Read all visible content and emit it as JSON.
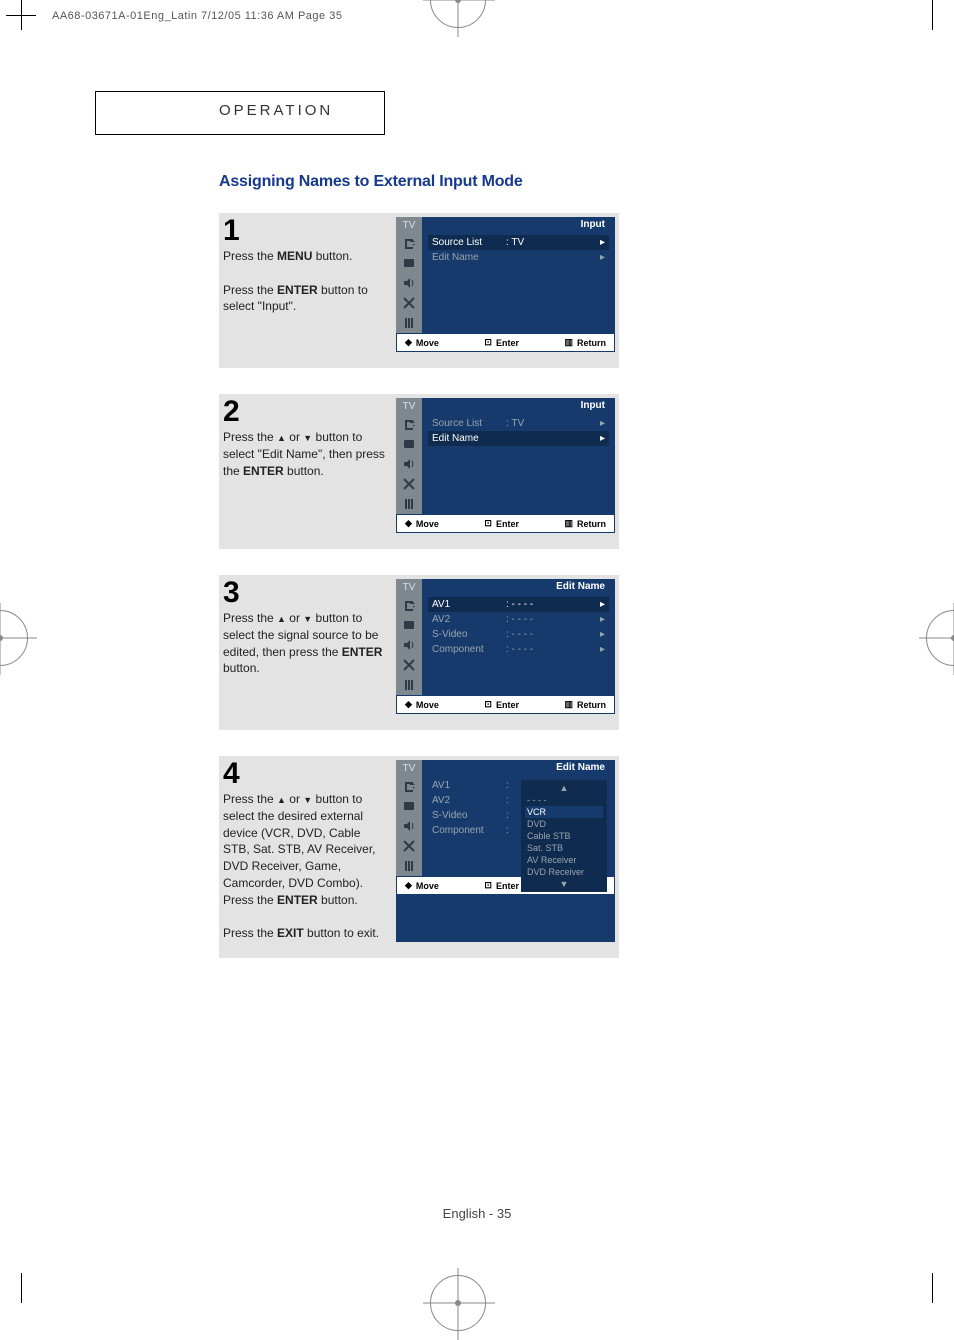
{
  "header_line": "AA68-03671A-01Eng_Latin  7/12/05  11:36 AM  Page 35",
  "section_name": "OPERATION",
  "title": "Assigning Names to External Input Mode",
  "footer": "English - 35",
  "step1": {
    "num": "1",
    "p1a": "Press the ",
    "p1b": "MENU",
    "p1c": " button.",
    "p2a": "Press the ",
    "p2b": "ENTER",
    "p2c": " button to select \"Input\"."
  },
  "step2": {
    "num": "2",
    "p1a": "Press the ",
    "p1b": " or ",
    "p1c": " button to select \"Edit Name\", then press the ",
    "p1d": "ENTER",
    "p1e": " button."
  },
  "step3": {
    "num": "3",
    "p1a": "Press the ",
    "p1b": " or ",
    "p1c": " button to select the signal source to be edited, then press the ",
    "p1d": "ENTER",
    "p1e": " button."
  },
  "step4": {
    "num": "4",
    "p1a": "Press the ",
    "p1b": " or ",
    "p1c": " button to select the desired external device (VCR, DVD, Cable STB, Sat. STB, AV Receiver, DVD Receiver, Game, Camcorder, DVD Combo).",
    "p2a": "Press the ",
    "p2b": "ENTER",
    "p2c": " button.",
    "p3a": "Press the ",
    "p3b": "EXIT",
    "p3c": " button to exit."
  },
  "osd_common": {
    "tv_badge": "TV",
    "move": "Move",
    "enter": "Enter",
    "return": "Return"
  },
  "osd1": {
    "title": "Input",
    "rows": [
      {
        "label": "Source List",
        "value": ": TV",
        "sel": true
      },
      {
        "label": "Edit Name",
        "value": "",
        "sel": false
      }
    ]
  },
  "osd2": {
    "title": "Input",
    "rows": [
      {
        "label": "Source List",
        "value": ": TV",
        "sel": false
      },
      {
        "label": "Edit Name",
        "value": "",
        "sel": true
      }
    ]
  },
  "osd3": {
    "title": "Edit Name",
    "rows": [
      {
        "label": "AV1",
        "value": ":  - - - -",
        "sel": true
      },
      {
        "label": "AV2",
        "value": ":  - - - -",
        "sel": false
      },
      {
        "label": "S-Video",
        "value": ":  - - - -",
        "sel": false
      },
      {
        "label": "Component",
        "value": ":  - - - -",
        "sel": false
      }
    ]
  },
  "osd4": {
    "title": "Edit Name",
    "rows": [
      {
        "label": "AV1",
        "value": ":",
        "sel": false
      },
      {
        "label": "AV2",
        "value": ":",
        "sel": false
      },
      {
        "label": "S-Video",
        "value": ":",
        "sel": false
      },
      {
        "label": "Component",
        "value": ":",
        "sel": false
      }
    ],
    "options": [
      "- - - -",
      "VCR",
      "DVD",
      "Cable STB",
      "Sat. STB",
      "AV Receiver",
      "DVD Receiver"
    ],
    "selected_option_index": 1
  }
}
